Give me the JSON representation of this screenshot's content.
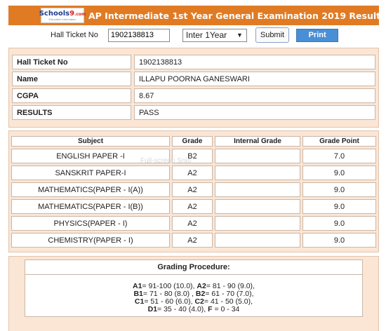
{
  "header": {
    "logo_brand": "Schools",
    "logo_nine": "9",
    "logo_com": ".com",
    "logo_tag": "Education Information",
    "title": "AP Intermediate 1st Year General Examination 2019 Results"
  },
  "form": {
    "hall_ticket_label": "Hall Ticket No",
    "hall_ticket_value": "1902138813",
    "year_selected": "Inter 1Year",
    "submit_label": "Submit",
    "print_label": "Print"
  },
  "info": [
    {
      "key": "Hall Ticket No",
      "value": "1902138813"
    },
    {
      "key": "Name",
      "value": "ILLAPU POORNA GANESWARI"
    },
    {
      "key": "CGPA",
      "value": "8.67"
    },
    {
      "key": "RESULTS",
      "value": "PASS"
    }
  ],
  "marks": {
    "headers": [
      "Subject",
      "Grade",
      "Internal Grade",
      "Grade Point"
    ],
    "rows": [
      {
        "subject": "ENGLISH PAPER -I",
        "grade": "B2",
        "internal": "",
        "point": "7.0"
      },
      {
        "subject": "SANSKRIT PAPER-I",
        "grade": "A2",
        "internal": "",
        "point": "9.0"
      },
      {
        "subject": "MATHEMATICS(PAPER - I(A))",
        "grade": "A2",
        "internal": "",
        "point": "9.0"
      },
      {
        "subject": "MATHEMATICS(PAPER - I(B))",
        "grade": "A2",
        "internal": "",
        "point": "9.0"
      },
      {
        "subject": "PHYSICS(PAPER - I)",
        "grade": "A2",
        "internal": "",
        "point": "9.0"
      },
      {
        "subject": "CHEMISTRY(PAPER - I)",
        "grade": "A2",
        "internal": "",
        "point": "9.0"
      }
    ]
  },
  "watermark": "Full-screen Snip",
  "grading": {
    "title": "Grading Procedure:",
    "lines": [
      [
        {
          "g": "A1",
          "r": "= 91-100 (10.0), "
        },
        {
          "g": "A2",
          "r": "= 81 - 90 (9.0),"
        }
      ],
      [
        {
          "g": "B1",
          "r": "= 71 - 80 (8.0) , "
        },
        {
          "g": "B2",
          "r": "= 61 - 70 (7.0),"
        }
      ],
      [
        {
          "g": "C1",
          "r": "= 51 - 60 (6.0), "
        },
        {
          "g": "C2",
          "r": "= 41 - 50 (5.0),"
        }
      ],
      [
        {
          "g": "D1",
          "r": "= 35 - 40 (4.0), "
        },
        {
          "g": "F",
          "r": " = 0 - 34"
        }
      ]
    ]
  },
  "colors": {
    "header_bg": "#e07b24",
    "panel_bg": "#fbe6d5",
    "print_button": "#4a8fd6"
  }
}
